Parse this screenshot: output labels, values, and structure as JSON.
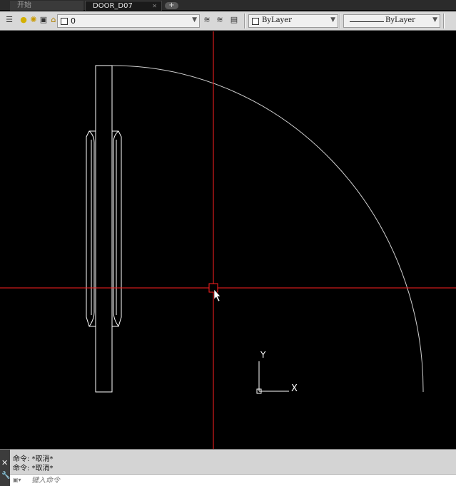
{
  "tabs": [
    {
      "label": "开始"
    },
    {
      "label": "DOOR_D07"
    }
  ],
  "tab_add_label": "+",
  "toolbar": {
    "current_layer": "0",
    "color_value": "ByLayer",
    "linetype_value": "ByLayer"
  },
  "canvas": {
    "ucs_y_label": "Y",
    "ucs_x_label": "X"
  },
  "command": {
    "history": [
      "命令: *取消*",
      "命令: *取消*"
    ],
    "input_placeholder": "键入命令"
  },
  "colors": {
    "background": "#000000",
    "crosshair": "#ff2020",
    "geometry": "#ffffff",
    "toolbar": "#d8d8d8"
  }
}
